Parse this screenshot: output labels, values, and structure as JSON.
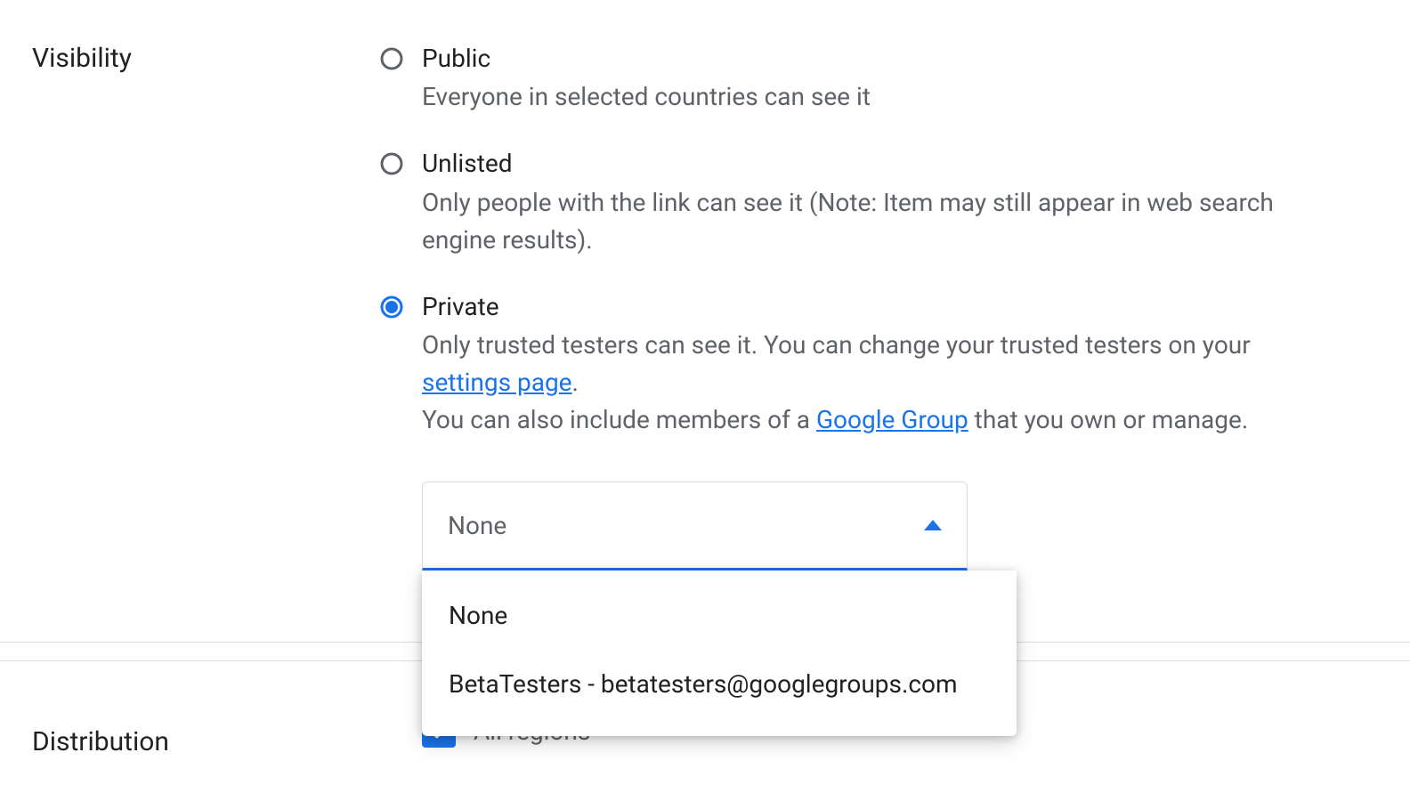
{
  "visibility": {
    "label": "Visibility",
    "options": [
      {
        "title": "Public",
        "desc": "Everyone in selected countries can see it",
        "selected": false
      },
      {
        "title": "Unlisted",
        "desc": "Only people with the link can see it (Note: Item may still appear in web search engine results).",
        "selected": false
      },
      {
        "title": "Private",
        "desc_pre": "Only trusted testers can see it. You can change your trusted testers on your ",
        "link1": "settings page",
        "desc_mid": ".",
        "desc_line2_pre": "You can also include members of a ",
        "link2": "Google Group",
        "desc_line2_post": " that you own or manage.",
        "selected": true
      }
    ],
    "dropdown": {
      "value": "None",
      "options": [
        "None",
        "BetaTesters - betatesters@googlegroups.com"
      ]
    }
  },
  "distribution": {
    "label": "Distribution",
    "all_regions": "All regions"
  }
}
